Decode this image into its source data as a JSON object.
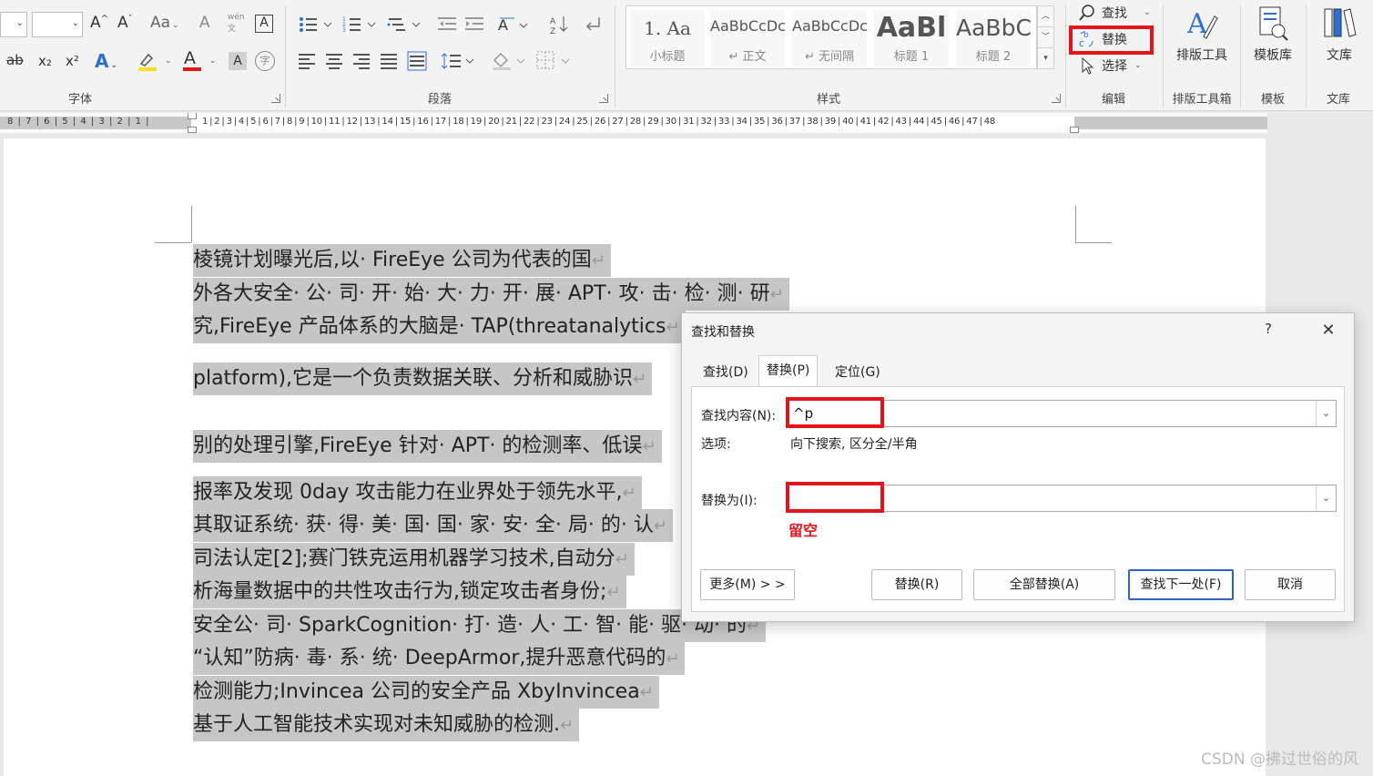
{
  "ribbon": {
    "font_group": {
      "label": "字体",
      "grow_icon": "A^",
      "shrink_icon": "Aˇ",
      "case_label": "Aa",
      "wen_label": "wén",
      "boxed_a": "A",
      "strike_label": "ab",
      "sub_label": "x₂",
      "sup_label": "x²",
      "text_effect": "A",
      "font_color": "A",
      "shade_a": "A",
      "circle_char": "字"
    },
    "paragraph_group": {
      "label": "段落"
    },
    "styles_group": {
      "label": "样式",
      "tiles": [
        {
          "sample": "1.   Aa",
          "name": "小标题"
        },
        {
          "sample": "AaBbCcDc",
          "name": "↵ 正文"
        },
        {
          "sample": "AaBbCcDc",
          "name": "↵ 无间隔"
        },
        {
          "sample": "AaBl",
          "name": "标题 1"
        },
        {
          "sample": "AaBbC",
          "name": "标题 2"
        }
      ]
    },
    "editing_group": {
      "label": "编辑",
      "find": "查找",
      "replace": "替换",
      "select": "选择"
    },
    "typeset_tools": {
      "button": "排版工具",
      "label": "排版工具箱"
    },
    "templates": {
      "button": "模板库",
      "label": "模板"
    },
    "library": {
      "button": "文库",
      "label": "文库"
    }
  },
  "ruler": {
    "left_numbers": "8 | 7 | 6 | 5 | 4 | 3 | 2 | 1 |",
    "right_numbers": "1 | 2 | 3 | 4 | 5 | 6 | 7 | 8 | 9 | 10 | 11 | 12 | 13 | 14 | 15 | 16 | 17 | 18 | 19 | 20 | 21 | 22 | 23 | 24 | 25 | 26 | 27 | 28 | 29 | 30 | 31 | 32 | 33 | 34 | 35 | 36 | 37 | 38 | 39 | 40 | 41 | 42 | 43 | 44 | 45 | 46 | 47 | 48"
  },
  "document": {
    "lines": [
      "棱镜计划曝光后,以· FireEye 公司为代表的国",
      "外各大安全· 公· 司· 开· 始· 大· 力· 开· 展· APT· 攻· 击· 检· 测· 研",
      "究,FireEye 产品体系的大脑是· TAP(threatanalytics",
      "platform),它是一个负责数据关联、分析和威胁识",
      "别的处理引擎,FireEye 针对· APT· 的检测率、低误",
      "报率及发现 0day 攻击能力在业界处于领先水平,",
      "其取证系统· 获· 得· 美· 国· 国· 家· 安· 全· 局· 的· 认",
      "司法认定[2];赛门铁克运用机器学习技术,自动分",
      "析海量数据中的共性攻击行为,锁定攻击者身份;",
      "安全公· 司· SparkCognition· 打· 造· 人· 工· 智· 能· 驱· 动· 的",
      "“认知”防病· 毒· 系· 统· DeepArmor,提升恶意代码的",
      "检测能力;Invincea 公司的安全产品 XbyInvincea",
      "基于人工智能技术实现对未知威胁的检测."
    ],
    "paragraph_mark": "↵"
  },
  "dialog": {
    "title": "查找和替换",
    "help": "?",
    "close": "✕",
    "tabs": [
      {
        "label": "查找(D)"
      },
      {
        "label": "替换(P)"
      },
      {
        "label": "定位(G)"
      }
    ],
    "find_label": "查找内容(N):",
    "find_value": "^p",
    "options_label": "选项:",
    "options_value": "向下搜索, 区分全/半角",
    "replace_label": "替换为(I):",
    "replace_value": "",
    "annotation": "留空",
    "buttons": {
      "more": "更多(M) > >",
      "replace": "替换(R)",
      "replace_all": "全部替换(A)",
      "find_next": "查找下一处(F)",
      "cancel": "取消"
    }
  },
  "watermark": "CSDN @拂过世俗的风",
  "colors": {
    "highlight_red": "#e4141b",
    "selection": "#c6c6c6",
    "accent_blue": "#2a64c7"
  }
}
